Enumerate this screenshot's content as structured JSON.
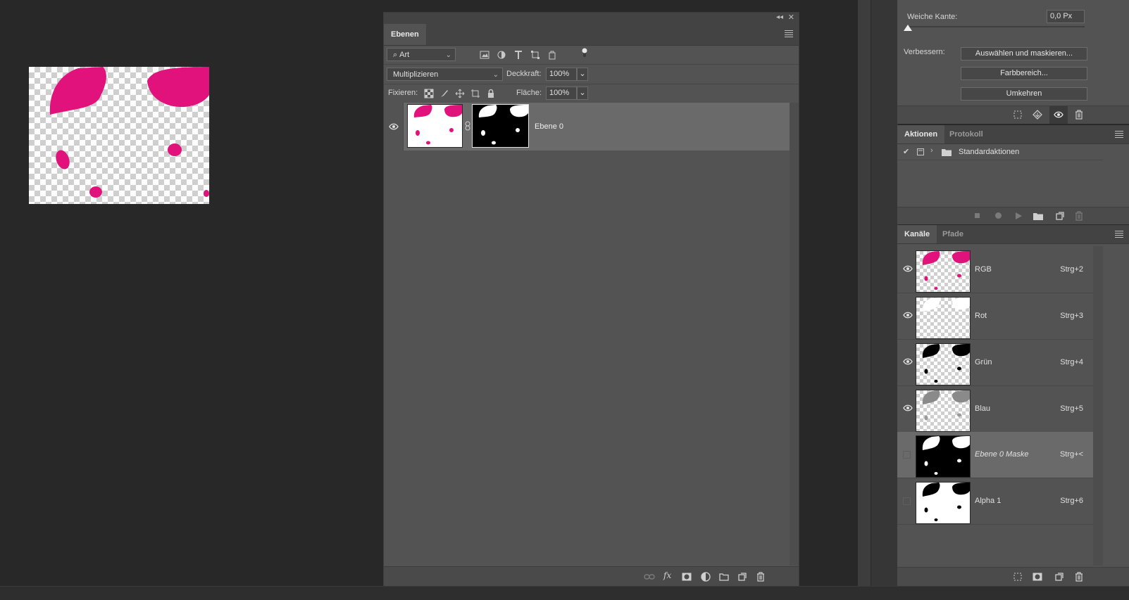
{
  "layers_panel": {
    "tab": "Ebenen",
    "filter": {
      "label": "Art"
    },
    "blend_mode": "Multiplizieren",
    "opacity": {
      "label": "Deckkraft:",
      "value": "100%"
    },
    "lock": {
      "label": "Fixieren:"
    },
    "fill": {
      "label": "Fläche:",
      "value": "100%"
    },
    "layer": {
      "name": "Ebene 0"
    }
  },
  "properties_panel": {
    "feather": {
      "label": "Weiche Kante:",
      "value": "0,0 Px"
    },
    "refine": {
      "label": "Verbessern:",
      "select_and_mask": "Auswählen und maskieren...",
      "color_range": "Farbbereich...",
      "invert": "Umkehren"
    }
  },
  "actions_panel": {
    "tabs": [
      "Aktionen",
      "Protokoll"
    ],
    "item": "Standardaktionen"
  },
  "channels_panel": {
    "tabs": [
      "Kanäle",
      "Pfade"
    ],
    "channels": [
      {
        "name": "RGB",
        "shortcut": "Strg+2"
      },
      {
        "name": "Rot",
        "shortcut": "Strg+3"
      },
      {
        "name": "Grün",
        "shortcut": "Strg+4"
      },
      {
        "name": "Blau",
        "shortcut": "Strg+5"
      },
      {
        "name": "Ebene 0 Maske",
        "shortcut": "Strg+<"
      },
      {
        "name": "Alpha 1",
        "shortcut": "Strg+6"
      }
    ]
  },
  "colors": {
    "magenta": "#e2127c",
    "panel": "#535353",
    "workspace": "#282828"
  }
}
